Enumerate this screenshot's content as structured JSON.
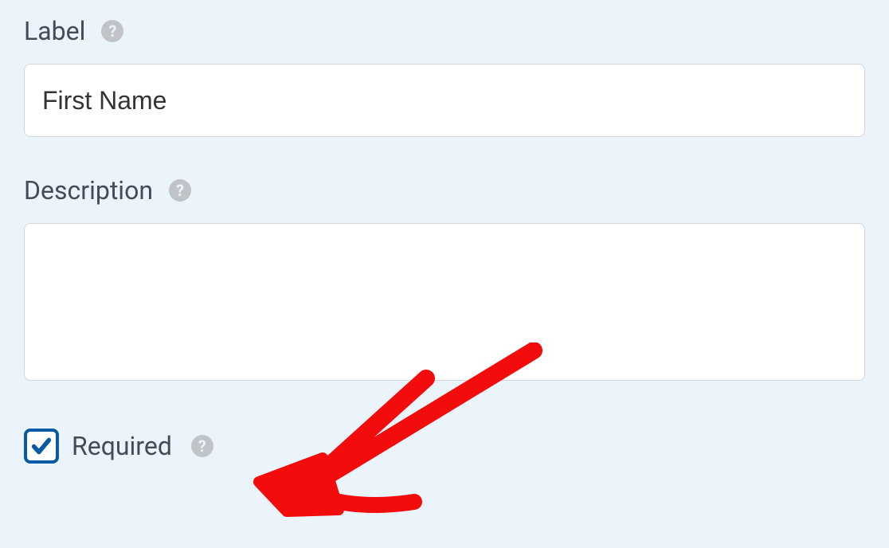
{
  "fields": {
    "label": {
      "title": "Label",
      "value": "First Name"
    },
    "description": {
      "title": "Description",
      "value": ""
    },
    "required": {
      "label": "Required",
      "checked": true
    }
  }
}
